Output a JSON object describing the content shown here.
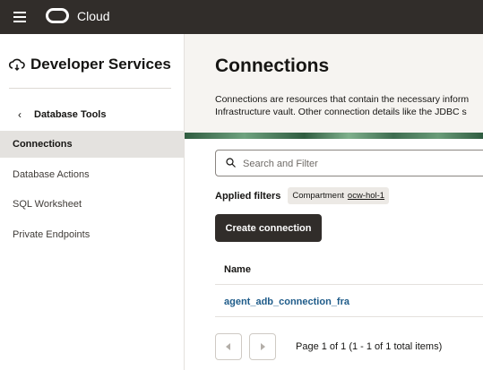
{
  "topbar": {
    "brand": "Cloud"
  },
  "sidebar": {
    "service_title": "Developer Services",
    "back_label": "Database Tools",
    "items": [
      {
        "label": "Connections",
        "active": true
      },
      {
        "label": "Database Actions",
        "active": false
      },
      {
        "label": "SQL Worksheet",
        "active": false
      },
      {
        "label": "Private Endpoints",
        "active": false
      }
    ]
  },
  "main": {
    "title": "Connections",
    "description_line1": "Connections are resources that contain the necessary inform",
    "description_line2": "Infrastructure vault. Other connection details like the JDBC s",
    "search_placeholder": "Search and Filter",
    "applied_filters_label": "Applied filters",
    "filter_chip": {
      "key": "Compartment",
      "value": "ocw-hol-1"
    },
    "create_button": "Create connection",
    "table": {
      "column_name": "Name",
      "rows": [
        {
          "name": "agent_adb_connection_fra"
        }
      ]
    },
    "pagination": {
      "text": "Page 1 of 1 (1 - 1 of 1 total items)"
    }
  },
  "colors": {
    "topbar": "#312d2a",
    "active_nav": "#e4e2df",
    "link": "#1f5c8a",
    "accent_band": "#2f5c40"
  }
}
